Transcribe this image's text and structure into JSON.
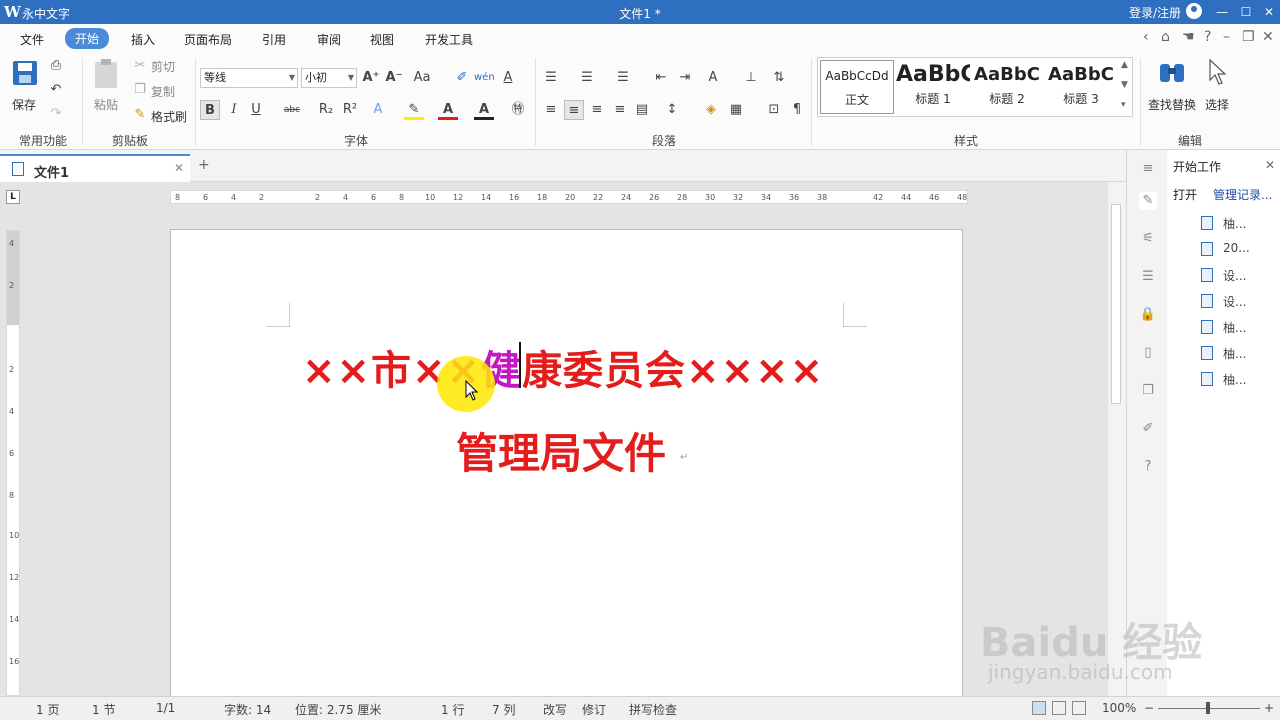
{
  "titlebar": {
    "logo": "W",
    "app_name": "永中文字",
    "doc_title": "文件1 *",
    "login": "登录/注册"
  },
  "menus": [
    "文件",
    "开始",
    "插入",
    "页面布局",
    "引用",
    "审阅",
    "视图",
    "开发工具"
  ],
  "ribbon": {
    "save": "保存",
    "paste": "粘贴",
    "cut": "剪切",
    "copy": "复制",
    "format_painter": "格式刷",
    "font_name": "等线",
    "font_size": "小初",
    "find_replace": "查找替换",
    "select": "选择",
    "groups": {
      "common": "常用功能",
      "clipboard": "剪贴板",
      "font": "字体",
      "paragraph": "段落",
      "styles": "样式",
      "edit": "编辑"
    },
    "styles": [
      {
        "preview": "AaBbCcDd",
        "name": "正文"
      },
      {
        "preview": "AaBbC",
        "name": "标题 1"
      },
      {
        "preview": "AaBbC",
        "name": "标题 2"
      },
      {
        "preview": "AaBbC",
        "name": "标题 3"
      }
    ]
  },
  "tab": {
    "label": "文件1",
    "add": "+"
  },
  "ruler": {
    "h_ticks": [
      "8",
      "6",
      "4",
      "2",
      "2",
      "4",
      "6",
      "8",
      "10",
      "12",
      "14",
      "16",
      "18",
      "20",
      "22",
      "24",
      "26",
      "28",
      "30",
      "32",
      "34",
      "36",
      "38",
      "42",
      "44",
      "46",
      "48"
    ],
    "v_ticks": [
      "4",
      "2",
      "2",
      "4",
      "6",
      "8",
      "10",
      "12",
      "14",
      "16"
    ],
    "corner": "L"
  },
  "document": {
    "line1_a": "××市×",
    "line1_sel": "×健",
    "line1_b": "康委员会××××",
    "line2": "管理局文件",
    "para_mark": "↵"
  },
  "sidebar": {
    "title": "开始工作",
    "open": "打开",
    "manage": "管理记录...",
    "recent": [
      "柚...",
      "20...",
      "设...",
      "设...",
      "柚...",
      "柚...",
      "柚..."
    ]
  },
  "status": {
    "page": "1 页",
    "section": "1 节",
    "page_of": "1/1",
    "words": "字数: 14",
    "position": "位置: 2.75 厘米",
    "line": "1 行",
    "column": "7 列",
    "overwrite": "改写",
    "revise": "修订",
    "spell": "拼写检查",
    "zoom": "100%"
  },
  "watermark": {
    "brand": "Baidu 经验",
    "url": "jingyan.baidu.com"
  },
  "colors": {
    "accent": "#2f6fbf",
    "heading_red": "#e31c1c",
    "selection_magenta": "#c218c2"
  }
}
